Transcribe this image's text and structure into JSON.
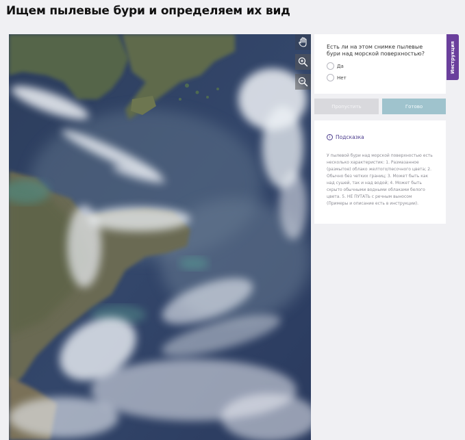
{
  "page": {
    "title": "Ищем пылевые бури и определяем их вид"
  },
  "tools": {
    "pan_icon": "hand-icon",
    "zoom_in_icon": "zoom-in-icon",
    "zoom_out_icon": "zoom-out-icon"
  },
  "question": {
    "text": "Есть ли на этом снимке пылевые бури над морской поверхностью?",
    "options": [
      {
        "label": "Да",
        "selected": false
      },
      {
        "label": "Нет",
        "selected": false
      }
    ]
  },
  "instructions_tab": {
    "label": "Инструкция"
  },
  "buttons": {
    "skip": "Пропустить",
    "done": "Готово"
  },
  "hint": {
    "title": "Подсказка",
    "text": "У пылевой бури над морской поверхностью есть несколько характеристик: 1. Размазанное (размытое) облако желтого/песочного цвета; 2. Обычно без четких границ; 3. Может быть как над сушей, так и над водой; 4. Может быть скрыто обычными водными облаками белого цвета. 5. НЕ ПУТАТЬ с речным выносом (Примеры и описание есть в инструкции)."
  },
  "colors": {
    "accent_purple": "#6a3f9c",
    "done_button": "#9fc3cd",
    "skip_button": "#d9d9dd",
    "page_background": "#f0f0f3"
  }
}
